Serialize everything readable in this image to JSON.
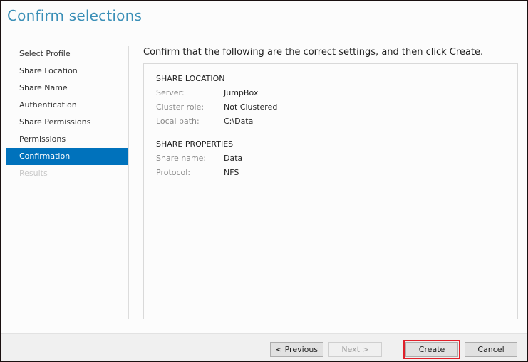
{
  "window": {
    "title": "Confirm selections"
  },
  "sidebar": {
    "items": [
      {
        "label": "Select Profile",
        "state": "normal"
      },
      {
        "label": "Share Location",
        "state": "normal"
      },
      {
        "label": "Share Name",
        "state": "normal"
      },
      {
        "label": "Authentication",
        "state": "normal"
      },
      {
        "label": "Share Permissions",
        "state": "normal"
      },
      {
        "label": "Permissions",
        "state": "normal"
      },
      {
        "label": "Confirmation",
        "state": "selected"
      },
      {
        "label": "Results",
        "state": "disabled"
      }
    ]
  },
  "main": {
    "instruction": "Confirm that the following are the correct settings, and then click Create.",
    "sections": [
      {
        "title": "SHARE LOCATION",
        "rows": [
          {
            "label": "Server:",
            "value": "JumpBox"
          },
          {
            "label": "Cluster role:",
            "value": "Not Clustered"
          },
          {
            "label": "Local path:",
            "value": "C:\\Data"
          }
        ]
      },
      {
        "title": "SHARE PROPERTIES",
        "rows": [
          {
            "label": "Share name:",
            "value": "Data"
          },
          {
            "label": "Protocol:",
            "value": "NFS"
          }
        ]
      }
    ]
  },
  "footer": {
    "previous_label": "< Previous",
    "next_label": "Next >",
    "create_label": "Create",
    "cancel_label": "Cancel"
  },
  "colors": {
    "accent": "#0072bc",
    "title": "#3a8fb7",
    "highlight": "#e0202a"
  }
}
